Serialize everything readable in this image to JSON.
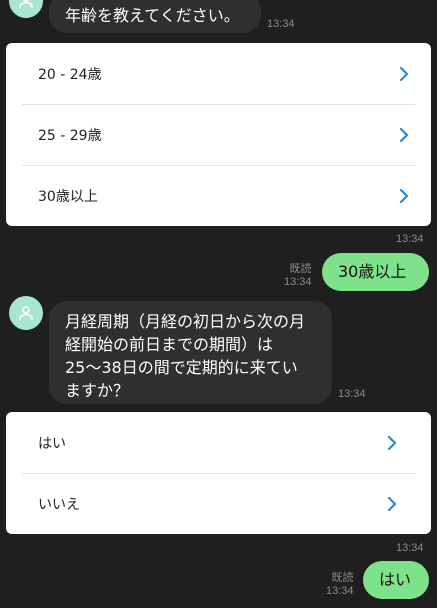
{
  "messages": {
    "m1": {
      "text": "年齢を教えてください。",
      "time": "13:34"
    },
    "age_options": {
      "items": [
        {
          "label": "20 - 24歳"
        },
        {
          "label": "25 - 29歳"
        },
        {
          "label": "30歳以上"
        }
      ],
      "time": "13:34"
    },
    "u1": {
      "text": "30歳以上",
      "read": "既読",
      "time": "13:34"
    },
    "m2": {
      "lines": [
        "月経周期（月経の初日から次の月",
        "経開始の前日までの期間）は",
        "25～38日の間で定期的に来てい",
        "ますか？"
      ],
      "time": "13:34"
    },
    "yesno_options": {
      "items": [
        {
          "label": "はい"
        },
        {
          "label": "いいえ"
        }
      ],
      "time": "13:34"
    },
    "u2": {
      "text": "はい",
      "read": "既読",
      "time": "13:34"
    }
  },
  "icons": {
    "avatar": "person-icon",
    "option_arrow": "chevron-right-icon"
  },
  "colors": {
    "background": "#1f1f1f",
    "bot_bubble": "#2f2f2f",
    "user_bubble": "#7ee28a",
    "avatar": "#a8e6cf",
    "chevron": "#2a8ad4",
    "timestamp": "#8a8a8a"
  }
}
